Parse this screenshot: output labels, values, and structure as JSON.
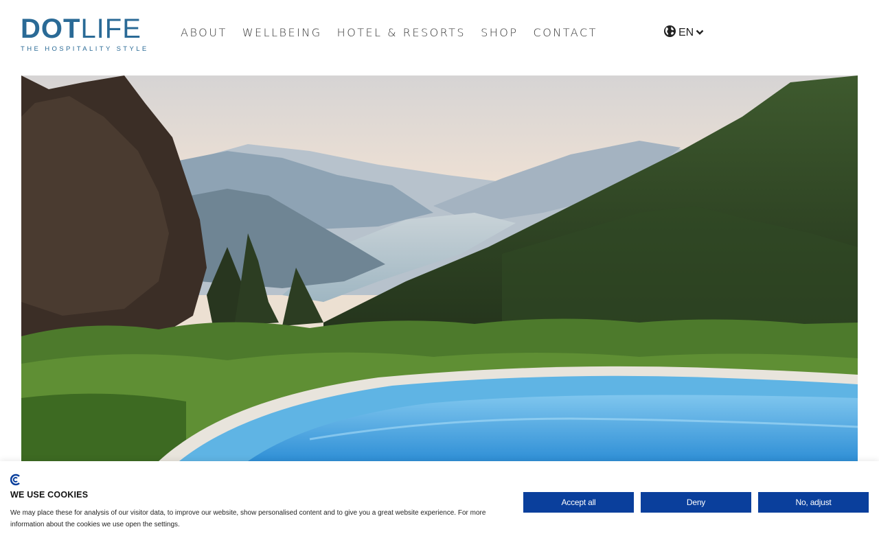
{
  "logo": {
    "main_dot": "DOT",
    "main_life": "LIFE",
    "tagline": "THE HOSPITALITY STYLE"
  },
  "nav": {
    "items": [
      {
        "label": "ABOUT"
      },
      {
        "label": "WELLBEING"
      },
      {
        "label": "HOTEL & RESORTS"
      },
      {
        "label": "SHOP"
      },
      {
        "label": "CONTACT"
      }
    ]
  },
  "language": {
    "label": "EN",
    "icon": "globe-icon"
  },
  "hero": {
    "description": "lake-mountain-pool-landscape"
  },
  "cookie": {
    "icon": "cookie-consent-icon",
    "title": "WE USE COOKIES",
    "text": "We may place these for analysis of our visitor data, to improve our website, show personalised content and to give you a great website experience. For more information about the cookies we use open the settings.",
    "accept_label": "Accept all",
    "deny_label": "Deny",
    "adjust_label": "No, adjust"
  },
  "colors": {
    "brand": "#2a6a96",
    "button": "#0a3f9c"
  }
}
